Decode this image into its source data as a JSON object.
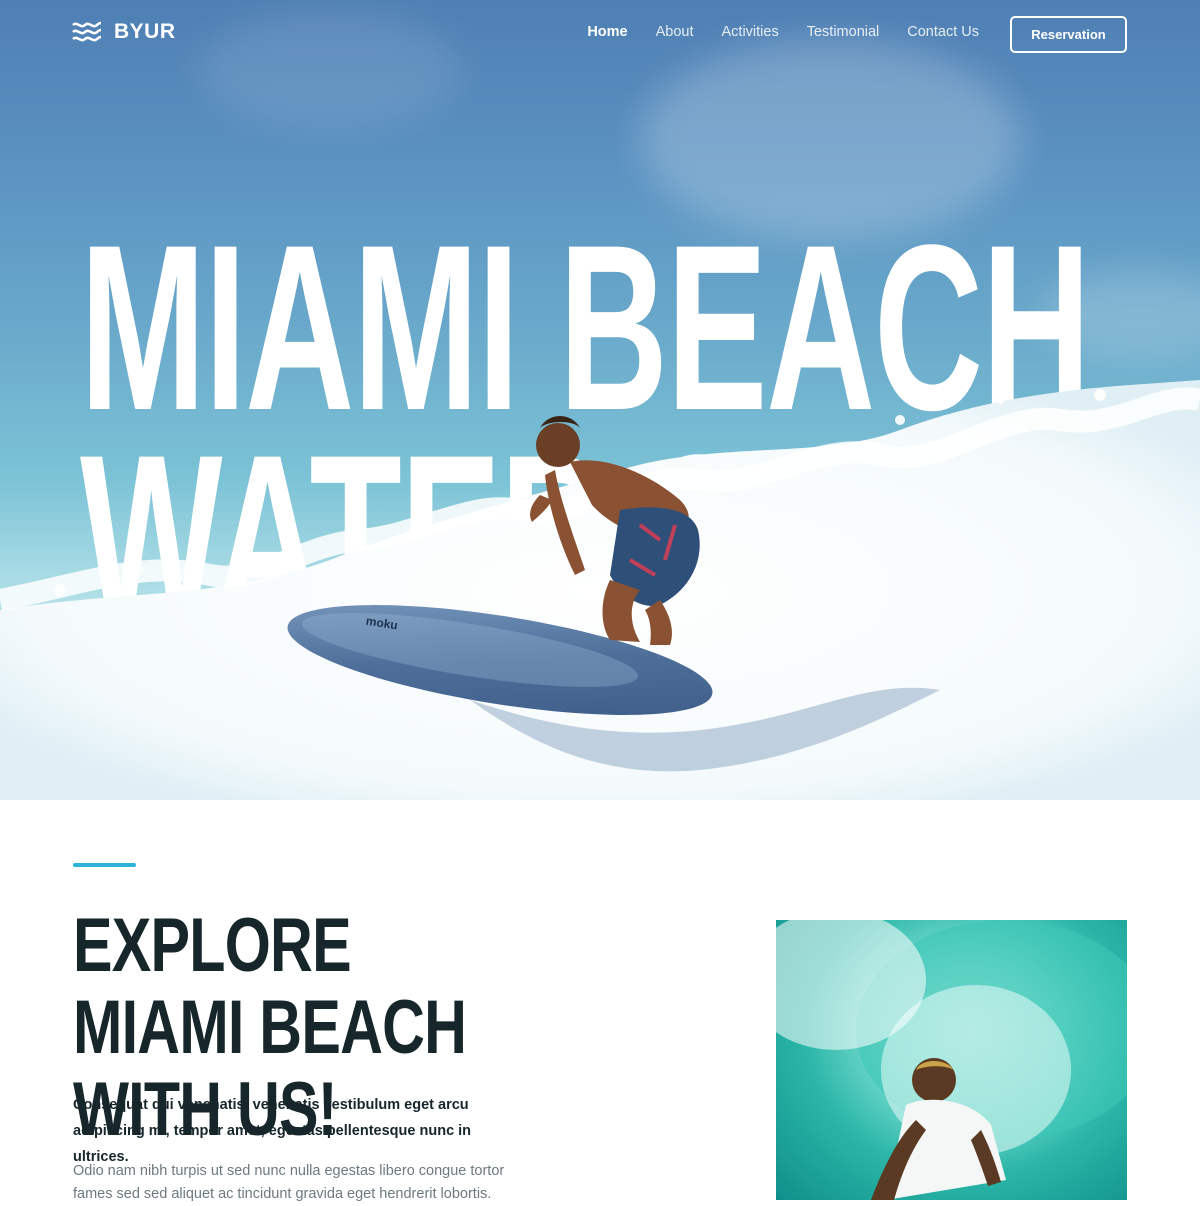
{
  "nav": {
    "brand": "BYUR",
    "items": [
      {
        "label": "Home",
        "active": true
      },
      {
        "label": "About",
        "active": false
      },
      {
        "label": "Activities",
        "active": false
      },
      {
        "label": "Testimonial",
        "active": false
      },
      {
        "label": "Contact Us",
        "active": false
      }
    ],
    "cta_label": "Reservation"
  },
  "hero": {
    "line1": "MIAMI BEACH",
    "line2": "WATER SPORTS",
    "image": "surfer-on-wave",
    "board_text": "moku"
  },
  "section": {
    "title": "EXPLORE MIAMI BEACH WITH US!",
    "lead": "Consequat dui venenatis, venenatis vestibulum eget arcu adipiscing mi, tempor amet, egestas pellentesque nunc in ultrices.",
    "body": "Odio nam nibh turpis ut sed nunc nulla egestas libero congue tortor fames sed sed aliquet ac tincidunt gravida eget hendrerit lobortis.",
    "image": "surfer-in-barrel-wave"
  },
  "colors": {
    "accent": "#2bb3db",
    "heading": "#16262b",
    "body_text": "#6c7a80",
    "sky": "#4f7fb4"
  },
  "icons": {
    "logo": "waves-icon"
  }
}
